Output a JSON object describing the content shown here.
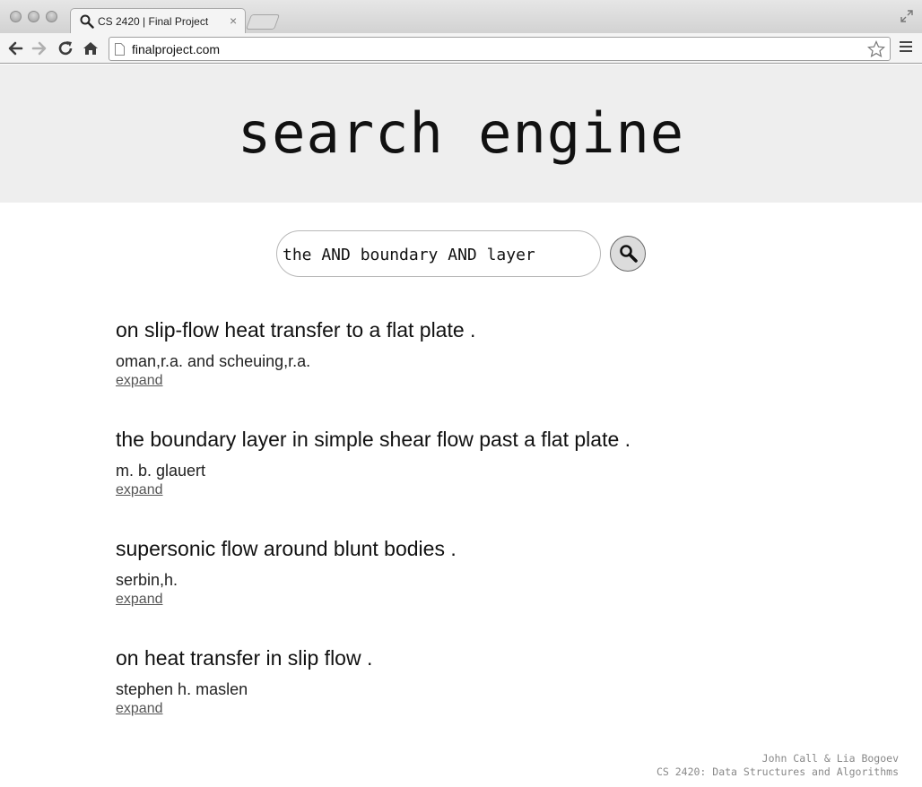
{
  "browser": {
    "tab_title": "CS 2420 | Final Project",
    "url": "finalproject.com",
    "icons": {
      "back": "back-arrow-icon",
      "forward": "forward-arrow-icon",
      "reload": "reload-icon",
      "home": "home-icon",
      "bookmark": "star-icon",
      "menu": "hamburger-menu-icon",
      "favicon": "search-icon"
    }
  },
  "header": {
    "title": "search engine",
    "background": "#eeeeee"
  },
  "search": {
    "query": "the AND boundary AND layer",
    "button_icon": "magnifier-icon"
  },
  "results": [
    {
      "title": "on slip-flow heat transfer to a flat plate .",
      "authors": "oman,r.a. and scheuing,r.a.",
      "expand_label": "expand"
    },
    {
      "title": "the boundary layer in simple shear flow past a flat plate .",
      "authors": "m. b. glauert",
      "expand_label": "expand"
    },
    {
      "title": "supersonic flow around blunt bodies .",
      "authors": "serbin,h.",
      "expand_label": "expand"
    },
    {
      "title": "on heat transfer in slip flow .",
      "authors": "stephen h. maslen",
      "expand_label": "expand"
    }
  ],
  "footer": {
    "line1": "John Call & Lia Bogoev",
    "line2": "CS 2420: Data Structures and Algorithms"
  }
}
